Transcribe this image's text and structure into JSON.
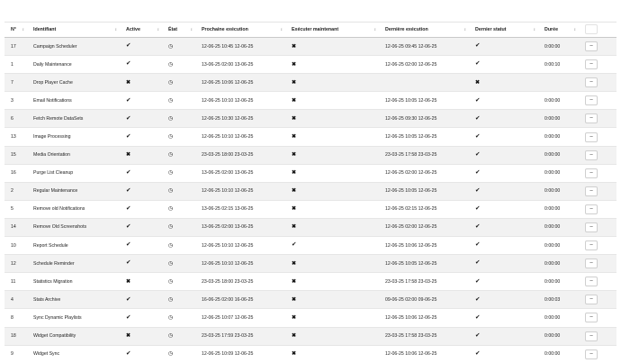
{
  "columns": {
    "num": "N°",
    "ident": "Identifiant",
    "active": "Active",
    "etat": "État",
    "next": "Prochaine exécution",
    "run_now": "Exécuter maintenant",
    "last": "Dernière exécution",
    "last_status": "Dernier statut",
    "duration": "Durée"
  },
  "icons": {
    "check": "✔",
    "cross": "✖",
    "clock": "◷",
    "sort": "↕",
    "action": "–"
  },
  "rows": [
    {
      "num": "17",
      "name": "Campaign Scheduler",
      "active": true,
      "next": "12-06-25 10:45 12-06-25",
      "run_now": false,
      "last": "12-06-25 09:45 12-06-25",
      "status": true,
      "duration": "0:00:00"
    },
    {
      "num": "1",
      "name": "Daily Maintenance",
      "active": true,
      "next": "13-06-25 02:00 13-06-25",
      "run_now": false,
      "last": "12-06-25 02:00 12-06-25",
      "status": true,
      "duration": "0:00:10"
    },
    {
      "num": "7",
      "name": "Drop Player Cache",
      "active": false,
      "next": "12-06-25 10:06 12-06-25",
      "run_now": false,
      "last": "",
      "status": false,
      "duration": ""
    },
    {
      "num": "3",
      "name": "Email Notifications",
      "active": true,
      "next": "12-06-25 10:10 12-06-25",
      "run_now": false,
      "last": "12-06-25 10:05 12-06-25",
      "status": true,
      "duration": "0:00:00"
    },
    {
      "num": "6",
      "name": "Fetch Remote DataSets",
      "active": true,
      "next": "12-06-25 10:30 12-06-25",
      "run_now": false,
      "last": "12-06-25 09:30 12-06-25",
      "status": true,
      "duration": "0:00:00"
    },
    {
      "num": "13",
      "name": "Image Processing",
      "active": true,
      "next": "12-06-25 10:10 12-06-25",
      "run_now": false,
      "last": "12-06-25 10:05 12-06-25",
      "status": true,
      "duration": "0:00:00"
    },
    {
      "num": "15",
      "name": "Media Orientation",
      "active": false,
      "next": "23-03-25 18:00 23-03-25",
      "run_now": false,
      "last": "23-03-25 17:58 23-03-25",
      "status": true,
      "duration": "0:00:00"
    },
    {
      "num": "16",
      "name": "Purge List Cleanup",
      "active": true,
      "next": "13-06-25 02:00 13-06-25",
      "run_now": false,
      "last": "12-06-25 02:00 12-06-25",
      "status": true,
      "duration": "0:00:00"
    },
    {
      "num": "2",
      "name": "Regular Maintenance",
      "active": true,
      "next": "12-06-25 10:10 12-06-25",
      "run_now": false,
      "last": "12-06-25 10:05 12-06-25",
      "status": true,
      "duration": "0:00:00"
    },
    {
      "num": "5",
      "name": "Remove old Notifications",
      "active": true,
      "next": "13-06-25 02:15 13-06-25",
      "run_now": false,
      "last": "12-06-25 02:15 12-06-25",
      "status": true,
      "duration": "0:00:00"
    },
    {
      "num": "14",
      "name": "Remove Old Screenshots",
      "active": true,
      "next": "13-06-25 02:00 13-06-25",
      "run_now": false,
      "last": "12-06-25 02:00 12-06-25",
      "status": true,
      "duration": "0:00:00"
    },
    {
      "num": "10",
      "name": "Report Schedule",
      "active": true,
      "next": "12-06-25 10:10 12-06-25",
      "run_now": true,
      "last": "12-06-25 10:06 12-06-25",
      "status": true,
      "duration": "0:00:00"
    },
    {
      "num": "12",
      "name": "Schedule Reminder",
      "active": true,
      "next": "12-06-25 10:10 12-06-25",
      "run_now": false,
      "last": "12-06-25 10:05 12-06-25",
      "status": true,
      "duration": "0:00:00"
    },
    {
      "num": "11",
      "name": "Statistics Migration",
      "active": false,
      "next": "23-03-25 18:00 23-03-25",
      "run_now": false,
      "last": "23-03-25 17:58 23-03-25",
      "status": true,
      "duration": "0:00:00"
    },
    {
      "num": "4",
      "name": "Stats Archive",
      "active": true,
      "next": "16-06-25 02:00 16-06-25",
      "run_now": false,
      "last": "09-06-25 02:00 09-06-25",
      "status": true,
      "duration": "0:00:03"
    },
    {
      "num": "8",
      "name": "Sync Dynamic Playlists",
      "active": true,
      "next": "12-06-25 10:07 12-06-25",
      "run_now": false,
      "last": "12-06-25 10:06 12-06-25",
      "status": true,
      "duration": "0:00:00"
    },
    {
      "num": "18",
      "name": "Widget Compatibility",
      "active": false,
      "next": "23-03-25 17:59 23-03-25",
      "run_now": false,
      "last": "23-03-25 17:58 23-03-25",
      "status": true,
      "duration": "0:00:00"
    },
    {
      "num": "9",
      "name": "Widget Sync",
      "active": true,
      "next": "12-06-25 10:09 12-06-25",
      "run_now": false,
      "last": "12-06-25 10:06 12-06-25",
      "status": true,
      "duration": "0:00:00"
    }
  ]
}
